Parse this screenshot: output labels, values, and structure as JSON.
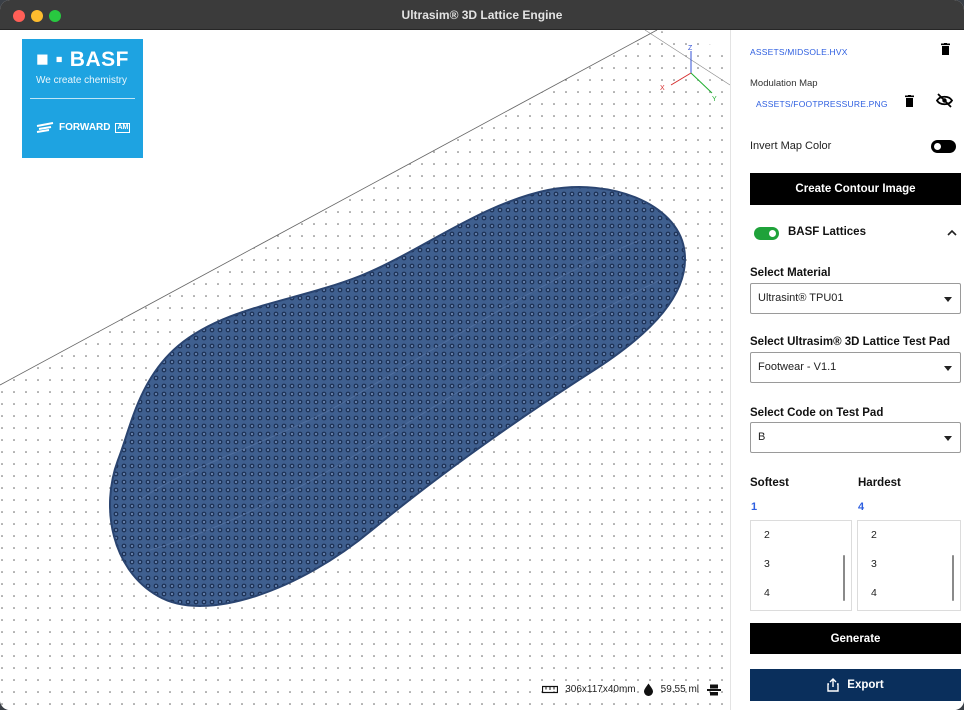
{
  "window": {
    "title": "Ultrasim® 3D Lattice Engine"
  },
  "logo": {
    "name": "■ ▪ BASF",
    "tagline": "We create chemistry",
    "forward": "FORWARD",
    "forward_suffix": "AM"
  },
  "viewport": {
    "axes": {
      "x": "X",
      "y": "Y",
      "z": "Z"
    },
    "dimensions": "306x117x40mm",
    "volume": "59.55 ml"
  },
  "panel": {
    "midsole_path": "ASSETS/MIDSOLE.HVX",
    "modulation_map_label": "Modulation Map",
    "modulation_map_path": "ASSETS/FOOTPRESSURE.PNG",
    "invert_map_label": "Invert Map Color",
    "create_contour_label": "Create Contour Image",
    "lattices_label": "BASF Lattices",
    "material_label": "Select Material",
    "material_value": "Ultrasint® TPU01",
    "testpad_label": "Select Ultrasim® 3D Lattice Test Pad",
    "testpad_value": "Footwear - V1.1",
    "code_label": "Select Code on Test Pad",
    "code_value": "B",
    "softest_label": "Softest",
    "softest_value": "1",
    "hardest_label": "Hardest",
    "hardest_value": "4",
    "softest_options": [
      "2",
      "3",
      "4"
    ],
    "hardest_options": [
      "2",
      "3",
      "4"
    ],
    "generate_label": "Generate",
    "export_label": "Export"
  },
  "colors": {
    "accent_link": "#2e5fe0",
    "lattice": "#3f5f8f",
    "export_button": "#0a2f5c",
    "toggle_on": "#1fa23a",
    "logo_bg": "#1ea3e1"
  }
}
